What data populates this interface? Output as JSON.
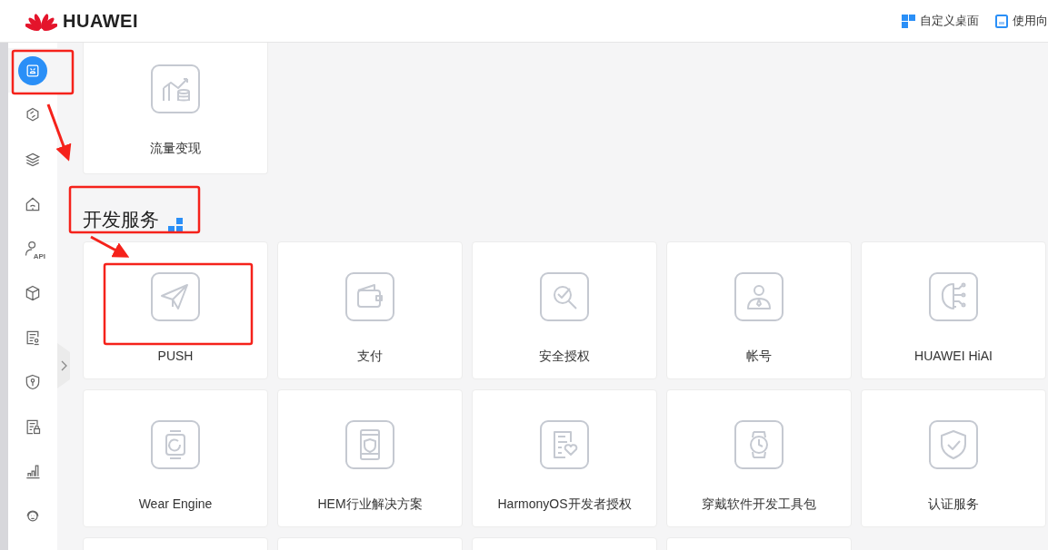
{
  "header": {
    "logo": "HUAWEI",
    "actions": [
      {
        "kind": "grid",
        "label": "自定义桌面"
      },
      {
        "kind": "guide",
        "label": "使用向"
      }
    ]
  },
  "sidebar": {
    "items": [
      {
        "kind": "app",
        "selected": true
      },
      {
        "kind": "hexagon",
        "selected": false
      },
      {
        "kind": "layers",
        "selected": false
      },
      {
        "kind": "home",
        "selected": false
      },
      {
        "kind": "api",
        "selected": false,
        "badge": "API"
      },
      {
        "kind": "cube",
        "selected": false
      },
      {
        "kind": "certificate",
        "selected": false
      },
      {
        "kind": "shield",
        "selected": false
      },
      {
        "kind": "doc-lock",
        "selected": false
      },
      {
        "kind": "bars",
        "selected": false
      },
      {
        "kind": "support",
        "selected": false
      }
    ]
  },
  "top_cards": [
    {
      "kind": "monetize",
      "label": "流量变现"
    }
  ],
  "section": {
    "title": "开发服务",
    "cards": [
      {
        "kind": "plane",
        "label": "PUSH"
      },
      {
        "kind": "wallet",
        "label": "支付"
      },
      {
        "kind": "scan",
        "label": "安全授权"
      },
      {
        "kind": "person",
        "label": "帐号"
      },
      {
        "kind": "brain",
        "label": "HUAWEI HiAI"
      },
      {
        "kind": "watch",
        "label": "Wear Engine"
      },
      {
        "kind": "phone",
        "label": "HEM行业解决方案"
      },
      {
        "kind": "handshake",
        "label": "HarmonyOS开发者授权"
      },
      {
        "kind": "clock",
        "label": "穿戴软件开发工具包"
      },
      {
        "kind": "shield",
        "label": "认证服务"
      },
      {
        "kind": "empty"
      },
      {
        "kind": "empty"
      },
      {
        "kind": "empty"
      },
      {
        "kind": "empty"
      }
    ]
  }
}
